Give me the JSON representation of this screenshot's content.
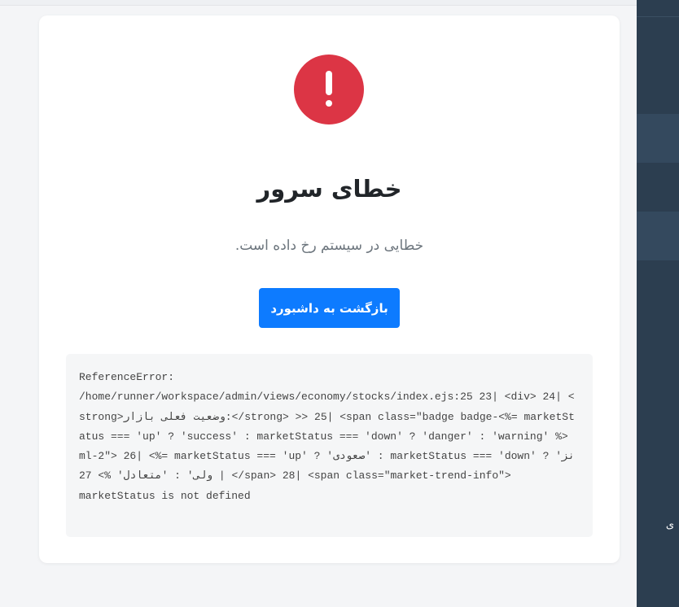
{
  "error": {
    "title": "خطای سرور",
    "message": "خطایی در سیستم رخ داده است.",
    "back_button": "بازگشت به داشبورد",
    "details": "ReferenceError:\n/home/runner/workspace/admin/views/economy/stocks/index.ejs:25 23| <div> 24| <strong>وضعیت فعلی بازار:</strong> >> 25| <span class=\"badge badge-<%= marketStatus === 'up' ? 'success' : marketStatus === 'down' ? 'danger' : 'warning' %> ml-2\"> 26| <%= marketStatus === 'up' ? 'صعودی' : marketStatus === 'down' ? 'نزولی' : 'متعادل' %> 27 | </span> 28| <span class=\"market-trend-info\">\nmarketStatus is not defined"
  },
  "sidebar": {
    "partial_text": "ی"
  },
  "colors": {
    "danger": "#dc3545",
    "primary": "#0d7bff",
    "sidebar_bg": "#2c3e50",
    "sidebar_active": "#34495e"
  },
  "icons": {
    "error": "exclamation-circle-icon"
  }
}
